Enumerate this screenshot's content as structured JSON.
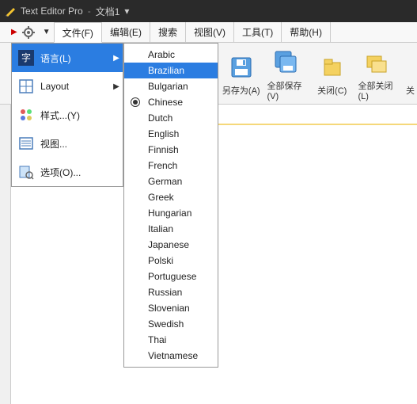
{
  "title": {
    "app": "Text Editor Pro",
    "doc": "文档1",
    "dropdown": "▾"
  },
  "menubar": {
    "tabs": [
      {
        "label": "文件(F)",
        "active": true
      },
      {
        "label": "编辑(E)"
      },
      {
        "label": "搜索"
      },
      {
        "label": "视图(V)"
      },
      {
        "label": "工具(T)"
      },
      {
        "label": "帮助(H)"
      }
    ]
  },
  "toolbar": {
    "items": [
      {
        "label": "另存为(A)"
      },
      {
        "label": "全部保存(V)"
      },
      {
        "label": "关闭(C)"
      },
      {
        "label": "全部关闭(L)"
      },
      {
        "label": "关"
      }
    ]
  },
  "settingsMenu": {
    "items": [
      {
        "label": "语言(L)",
        "icon": "lang",
        "selected": true,
        "submenu": true
      },
      {
        "label": "Layout",
        "icon": "layout",
        "submenu": true
      },
      {
        "label": "样式...(Y)",
        "icon": "style"
      },
      {
        "label": "视图...",
        "icon": "view"
      },
      {
        "label": "选项(O)...",
        "icon": "options"
      }
    ]
  },
  "languages": {
    "items": [
      {
        "label": "Arabic"
      },
      {
        "label": "Brazilian",
        "selected": true
      },
      {
        "label": "Bulgarian"
      },
      {
        "label": "Chinese",
        "checked": true
      },
      {
        "label": "Dutch"
      },
      {
        "label": "English"
      },
      {
        "label": "Finnish"
      },
      {
        "label": "French"
      },
      {
        "label": "German"
      },
      {
        "label": "Greek"
      },
      {
        "label": "Hungarian"
      },
      {
        "label": "Italian"
      },
      {
        "label": "Japanese"
      },
      {
        "label": "Polski"
      },
      {
        "label": "Portuguese"
      },
      {
        "label": "Russian"
      },
      {
        "label": "Slovenian"
      },
      {
        "label": "Swedish"
      },
      {
        "label": "Thai"
      },
      {
        "label": "Vietnamese"
      }
    ]
  }
}
